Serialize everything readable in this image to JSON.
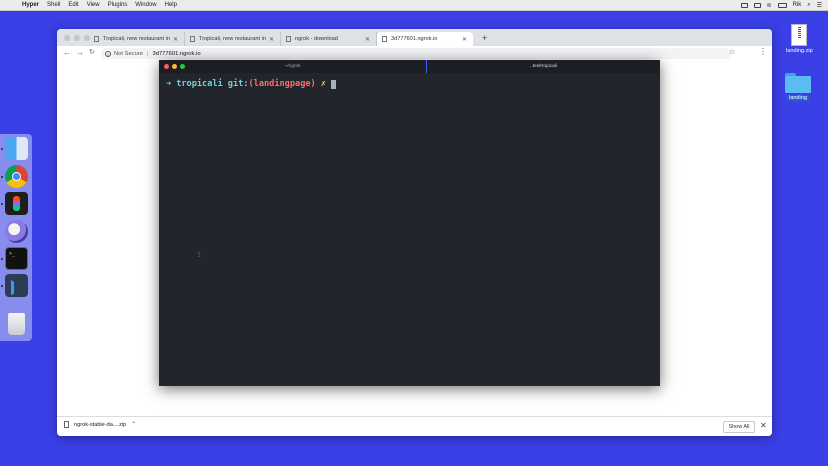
{
  "menubar": {
    "app": "Hyper",
    "items": [
      "Shell",
      "Edit",
      "View",
      "Plugins",
      "Window",
      "Help"
    ],
    "user": "Rik"
  },
  "browser": {
    "tabs": [
      {
        "title": "Tropicali, new restaurant in Sa"
      },
      {
        "title": "Tropicali, new restaurant in Sa"
      },
      {
        "title": "ngrok - download"
      },
      {
        "title": "3d777601.ngrok.io"
      }
    ],
    "address": {
      "security": "Not Secure",
      "url": "3d777601.ngrok.io"
    },
    "download": {
      "filename": "ngrok-stable-da....zip",
      "show_all": "Show All"
    }
  },
  "terminal": {
    "tabs": [
      {
        "title": "~/ngrok"
      },
      {
        "title": "..tes/tropicali"
      }
    ],
    "prompt": {
      "arrow": "➜",
      "dir": "tropicali",
      "git": "git:",
      "branch": "(landingpage)",
      "dirty": "✗"
    }
  },
  "dock": {
    "apps": [
      "finder-icon",
      "chrome-icon",
      "figma-icon",
      "sketch-icon",
      "terminal-icon",
      "vscode-icon",
      "trash-icon"
    ]
  },
  "desktop": {
    "items": [
      {
        "label": "landing.zip"
      },
      {
        "label": "landing"
      }
    ]
  },
  "colors": {
    "desktop": "#3a3fe6",
    "terminal_bg": "#22252c",
    "prompt_arrow": "#50fa7b",
    "prompt_dir": "#6fd3d9",
    "prompt_branch": "#ff6b6b",
    "prompt_dirty": "#f1d26a"
  }
}
